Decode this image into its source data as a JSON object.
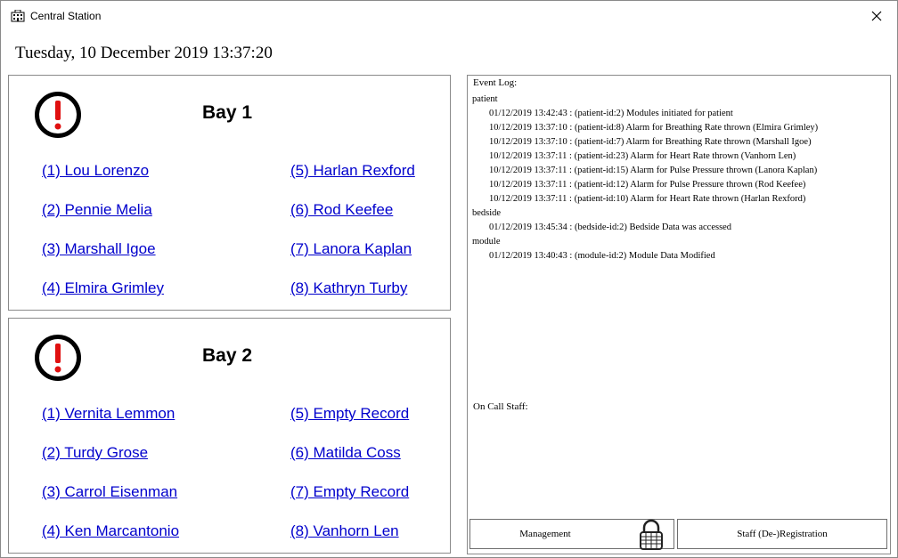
{
  "window": {
    "title": "Central Station"
  },
  "header": {
    "datetime": "Tuesday, 10 December 2019 13:37:20"
  },
  "bays": [
    {
      "title": "Bay 1",
      "patients": [
        "(1) Lou Lorenzo",
        "(2) Pennie Melia",
        "(3) Marshall Igoe",
        "(4) Elmira Grimley",
        "(5) Harlan Rexford",
        "(6) Rod Keefee",
        "(7) Lanora Kaplan",
        "(8) Kathryn Turby"
      ]
    },
    {
      "title": "Bay 2",
      "patients": [
        "(1) Vernita Lemmon",
        "(2) Turdy Grose",
        "(3) Carrol Eisenman",
        "(4) Ken Marcantonio",
        "(5) Empty Record",
        "(6) Matilda Coss",
        "(7) Empty Record",
        "(8) Vanhorn Len"
      ]
    }
  ],
  "event_log": {
    "heading": "Event Log:",
    "groups": [
      {
        "category": "patient",
        "entries": [
          "01/12/2019 13:42:43 : (patient-id:2) Modules initiated for patient",
          "10/12/2019 13:37:10 : (patient-id:8) Alarm for Breathing Rate thrown (Elmira Grimley)",
          "10/12/2019 13:37:10 : (patient-id:7) Alarm for Breathing Rate thrown (Marshall Igoe)",
          "10/12/2019 13:37:11 : (patient-id:23) Alarm for Heart Rate thrown (Vanhorn Len)",
          "10/12/2019 13:37:11 : (patient-id:15) Alarm for Pulse Pressure thrown (Lanora Kaplan)",
          "10/12/2019 13:37:11 : (patient-id:12) Alarm for Pulse Pressure thrown (Rod Keefee)",
          "10/12/2019 13:37:11 : (patient-id:10) Alarm for Heart Rate thrown (Harlan Rexford)"
        ]
      },
      {
        "category": "bedside",
        "entries": [
          "01/12/2019 13:45:34 : (bedside-id:2) Bedside Data was accessed"
        ]
      },
      {
        "category": "module",
        "entries": [
          "01/12/2019 13:40:43 : (module-id:2) Module Data Modified"
        ]
      }
    ]
  },
  "on_call": {
    "heading": "On Call Staff:"
  },
  "buttons": {
    "management": "Management",
    "staff_registration": "Staff (De-)Registration"
  },
  "icons": {
    "app": "building-icon",
    "close": "close-icon",
    "alarm": "alarm-exclamation-icon",
    "lock": "lock-icon"
  },
  "colors": {
    "link": "#0000cc",
    "alarm": "#e01010"
  }
}
